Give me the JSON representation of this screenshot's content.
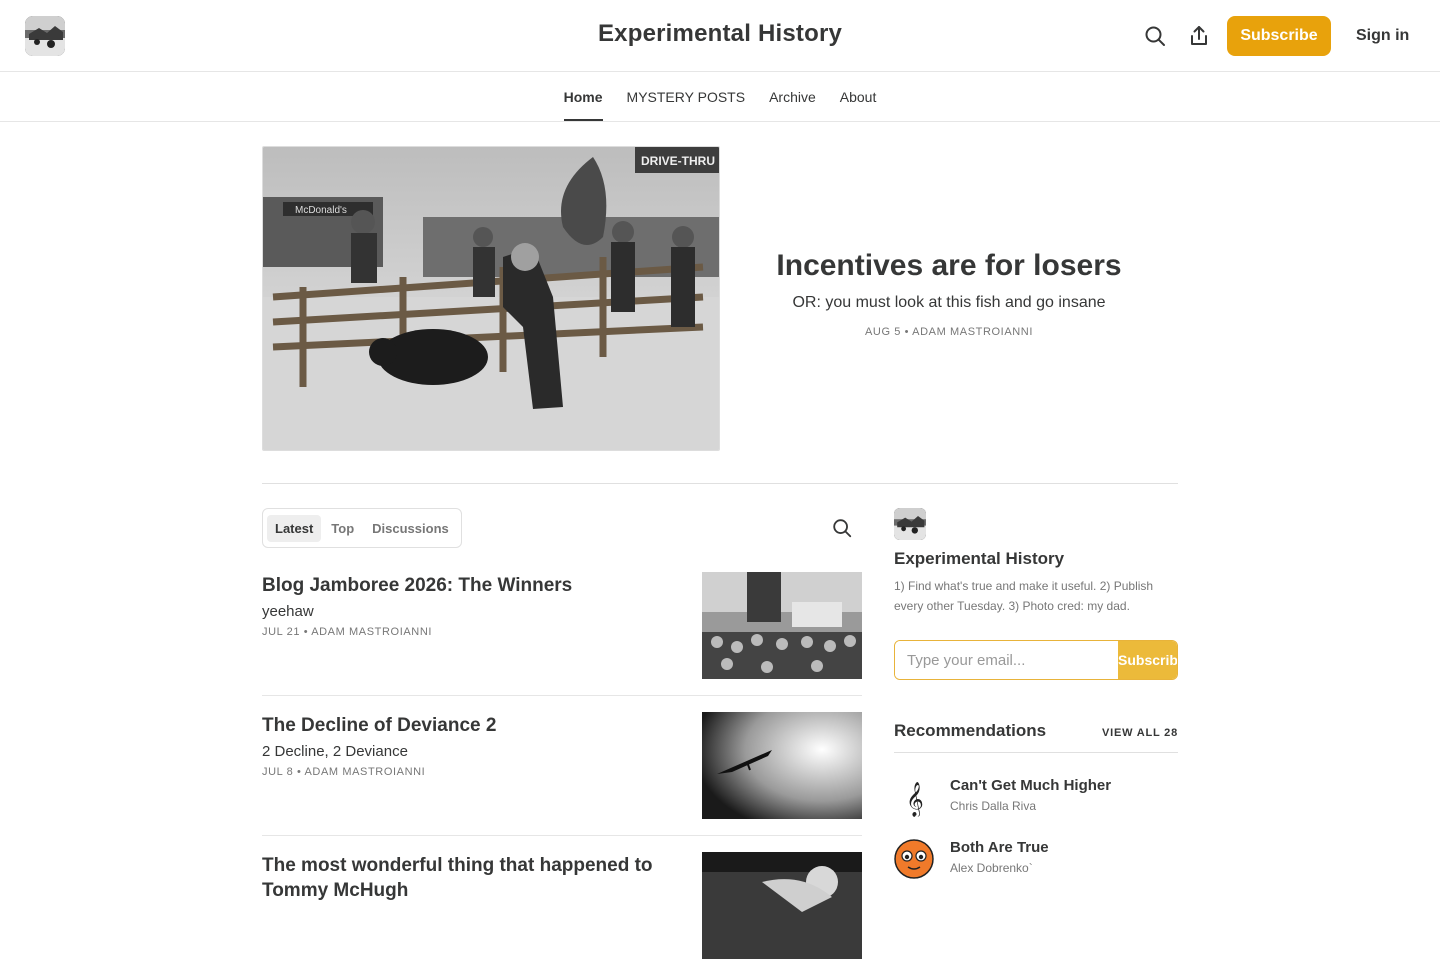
{
  "header": {
    "site_title": "Experimental History",
    "subscribe_label": "Subscribe",
    "signin_label": "Sign in",
    "accent_color": "#e8a20c"
  },
  "nav": {
    "items": [
      {
        "label": "Home",
        "active": true
      },
      {
        "label": "MYSTERY POSTS",
        "active": false
      },
      {
        "label": "Archive",
        "active": false
      },
      {
        "label": "About",
        "active": false
      }
    ]
  },
  "hero": {
    "title": "Incentives are for losers",
    "subtitle": "OR: you must look at this fish and go insane",
    "meta": "AUG 5 • ADAM MASTROIANNI",
    "image_text": "DRIVE-THRU",
    "image_sign": "McDonald's"
  },
  "feed": {
    "tabs": [
      {
        "label": "Latest",
        "active": true
      },
      {
        "label": "Top",
        "active": false
      },
      {
        "label": "Discussions",
        "active": false
      }
    ],
    "posts": [
      {
        "title": "Blog Jamboree 2026: The Winners",
        "subtitle": "yeehaw",
        "meta": "JUL 21 • ADAM MASTROIANNI"
      },
      {
        "title": "The Decline of Deviance 2",
        "subtitle": "2 Decline, 2 Deviance",
        "meta": "JUL 8 • ADAM MASTROIANNI"
      },
      {
        "title": "The most wonderful thing that happened to Tommy McHugh",
        "subtitle": "",
        "meta": ""
      }
    ]
  },
  "sidebar": {
    "title": "Experimental History",
    "description": "1) Find what's true and make it useful. 2) Publish every other Tuesday. 3) Photo cred: my dad.",
    "email_placeholder": "Type your email...",
    "subscribe_label": "Subscribe",
    "recommendations": {
      "heading": "Recommendations",
      "view_all": "VIEW ALL 28",
      "items": [
        {
          "name": "Can't Get Much Higher",
          "author": "Chris Dalla Riva",
          "icon": "treble-clef-icon"
        },
        {
          "name": "Both Are True",
          "author": "Alex Dobrenko`",
          "icon": "orange-face-icon"
        }
      ]
    }
  }
}
